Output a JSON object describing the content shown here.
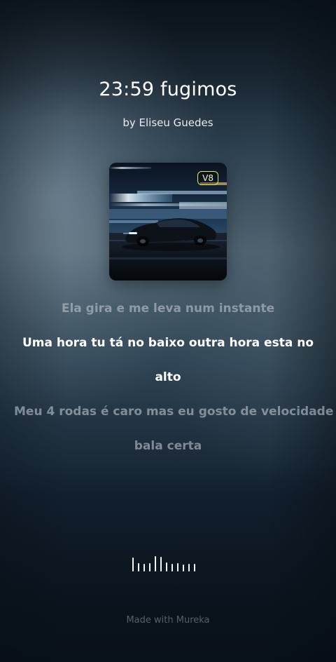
{
  "song": {
    "title": "23:59 fugimos",
    "artist_line": "by Eliseu Guedes"
  },
  "cover": {
    "badge": "V8"
  },
  "lyrics": {
    "line1": "Ela gira e me leva num instante",
    "line2a": "Uma hora tu tá no baixo outra hora esta no",
    "line2b": "alto",
    "line3": "Meu 4 rodas é caro mas eu gosto de velocidade",
    "line4": "bala certa"
  },
  "waveform": {
    "icon": "audio-waveform-icon",
    "levels": [
      0.9,
      0.55,
      0.5,
      0.55,
      1.0,
      0.95,
      0.6,
      0.5,
      0.55,
      0.45,
      0.5,
      0.5
    ]
  },
  "footer": {
    "text": "Made with Mureka"
  },
  "colors": {
    "active_lyric": "#ffffff",
    "inactive_lyric": "#b9c4cd",
    "badge_border": "#e7e35a"
  }
}
